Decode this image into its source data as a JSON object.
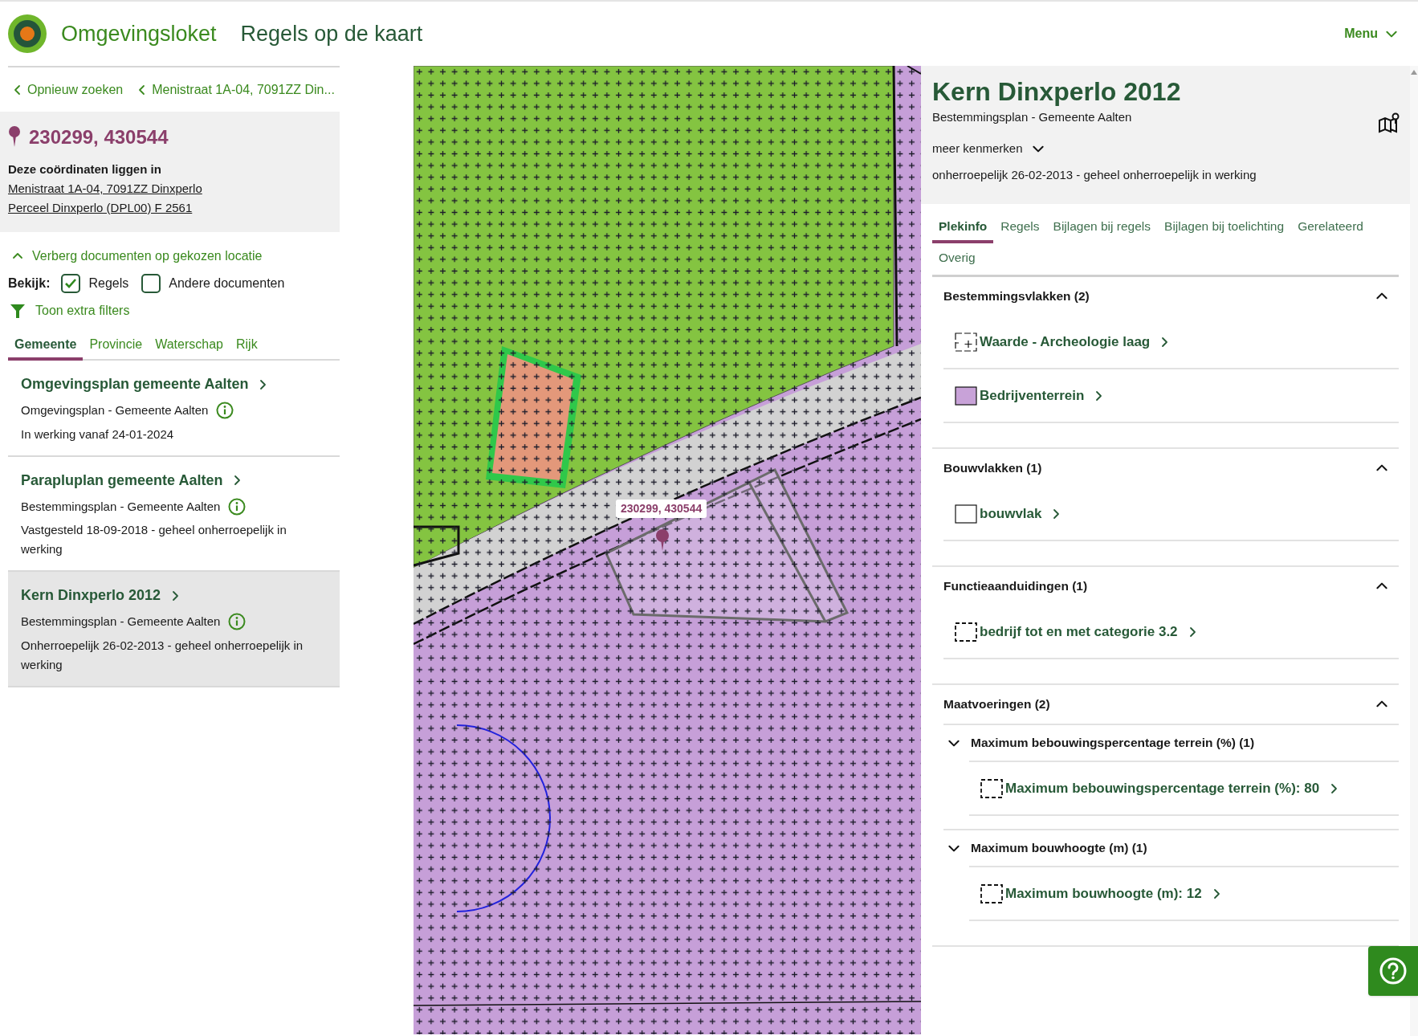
{
  "header": {
    "brand": "Omgevingsloket",
    "subtitle": "Regels op de kaart",
    "menu": "Menu"
  },
  "left": {
    "breadcrumbs": [
      "Opnieuw zoeken",
      "Menistraat 1A-04, 7091ZZ Din..."
    ],
    "location": {
      "coordinates": "230299, 430544",
      "intro": "Deze coördinaten liggen in",
      "links": [
        "Menistraat 1A-04, 7091ZZ Dinxperlo",
        "Perceel Dinxperlo (DPL00) F 2561"
      ]
    },
    "toggle": {
      "label": "Verberg documenten op gekozen locatie",
      "expanded": true
    },
    "view": {
      "label": "Bekijk:",
      "options": [
        {
          "label": "Regels",
          "checked": true
        },
        {
          "label": "Andere documenten",
          "checked": false
        }
      ]
    },
    "filters": "Toon extra filters",
    "tabs": [
      {
        "label": "Gemeente",
        "selected": true
      },
      {
        "label": "Provincie",
        "selected": false
      },
      {
        "label": "Waterschap",
        "selected": false
      },
      {
        "label": "Rijk",
        "selected": false
      }
    ],
    "documents": [
      {
        "title": "Omgevingsplan gemeente Aalten",
        "type": "Omgevingsplan - Gemeente Aalten",
        "status": "In werking vanaf 24-01-2024",
        "selected": false
      },
      {
        "title": "Parapluplan gemeente Aalten",
        "type": "Bestemmingsplan - Gemeente Aalten",
        "status": "Vastgesteld 18-09-2018 - geheel onherroepelijk in werking",
        "selected": false
      },
      {
        "title": "Kern Dinxperlo 2012",
        "type": "Bestemmingsplan - Gemeente Aalten",
        "status": "Onherroepelijk 26-02-2013 - geheel onherroepelijk in werking",
        "selected": true
      }
    ]
  },
  "map": {
    "marker_label": "230299, 430544"
  },
  "detail": {
    "title": "Kern Dinxperlo 2012",
    "subtitle": "Bestemmingsplan - Gemeente Aalten",
    "more": "meer kenmerken",
    "status": "onherroepelijk 26-02-2013 - geheel onherroepelijk in werking",
    "tabs": [
      {
        "label": "Plekinfo",
        "selected": true
      },
      {
        "label": "Regels",
        "selected": false
      },
      {
        "label": "Bijlagen bij regels",
        "selected": false
      },
      {
        "label": "Bijlagen bij toelichting",
        "selected": false
      },
      {
        "label": "Gerelateerd",
        "selected": false
      },
      {
        "label": "Overig",
        "selected": false
      }
    ],
    "sections": [
      {
        "heading": "Bestemmingsvlakken (2)",
        "expanded": true,
        "items": [
          {
            "label": "Waarde - Archeologie laag",
            "kind": "crosses"
          },
          {
            "label": "Bedrijventerrein",
            "kind": "fill",
            "color": "#c8a2d8"
          }
        ]
      },
      {
        "heading": "Bouwvlakken (1)",
        "expanded": true,
        "items": [
          {
            "label": "bouwvlak",
            "kind": "outline"
          }
        ]
      },
      {
        "heading": "Functieaanduidingen (1)",
        "expanded": true,
        "items": [
          {
            "label": "bedrijf tot en met categorie 3.2",
            "kind": "dashed"
          }
        ]
      },
      {
        "heading": "Maatvoeringen (2)",
        "expanded": true,
        "groups": [
          {
            "heading": "Maximum bebouwingspercentage terrein (%) (1)",
            "expanded": true,
            "items": [
              {
                "label": "Maximum bebouwingspercentage terrein (%): 80",
                "kind": "dashed"
              }
            ]
          },
          {
            "heading": "Maximum bouwhoogte (m) (1)",
            "expanded": true,
            "items": [
              {
                "label": "Maximum bouwhoogte (m): 12",
                "kind": "dashed"
              }
            ]
          }
        ]
      }
    ]
  }
}
